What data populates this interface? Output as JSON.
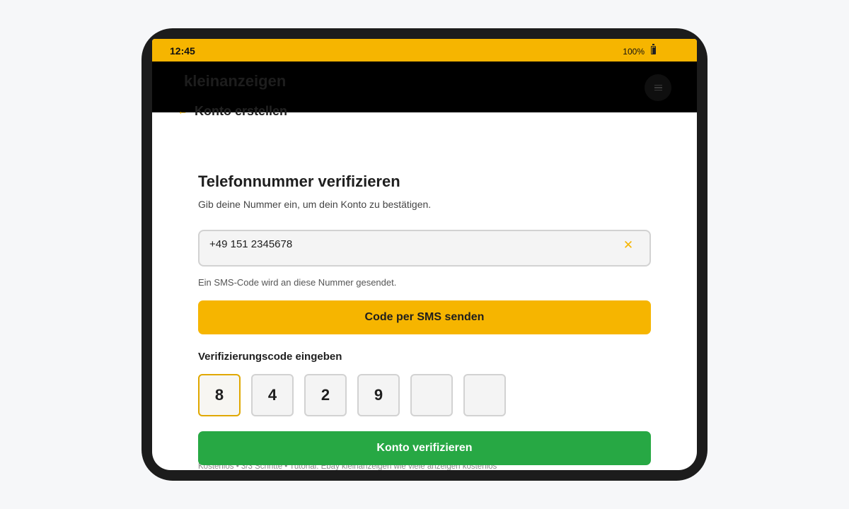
{
  "status_bar": {
    "time": "12:45",
    "battery": "100%",
    "battery_icon": "battery-icon"
  },
  "header": {
    "logo": "kleinanzeigen",
    "menu_icon": "menu-icon"
  },
  "nav": {
    "back_icon": "arrow-left-icon",
    "title": "Konto erstellen"
  },
  "page": {
    "title": "Telefonnummer verifizieren",
    "subtitle": "Gib deine Nummer ein, um dein Konto zu bestätigen."
  },
  "phone": {
    "value": "+49 151 2345678",
    "clear_icon": "close-icon",
    "clear_glyph": "✕"
  },
  "hint": "Ein SMS-Code wird an diese Nummer gesendet.",
  "send_button": "Code per SMS senden",
  "code": {
    "label": "Verifizierungscode eingeben",
    "digits": [
      "8",
      "4",
      "2",
      "9",
      "",
      ""
    ]
  },
  "verify_button": "Konto verifizieren",
  "footer_note": "Kostenlos • 3/3 Schritte • Tutorial: Ebay kleinanzeigen wie viele anzeigen kostenlos",
  "colors": {
    "accent": "#f6b500",
    "success": "#27a844",
    "header": "#000000"
  }
}
